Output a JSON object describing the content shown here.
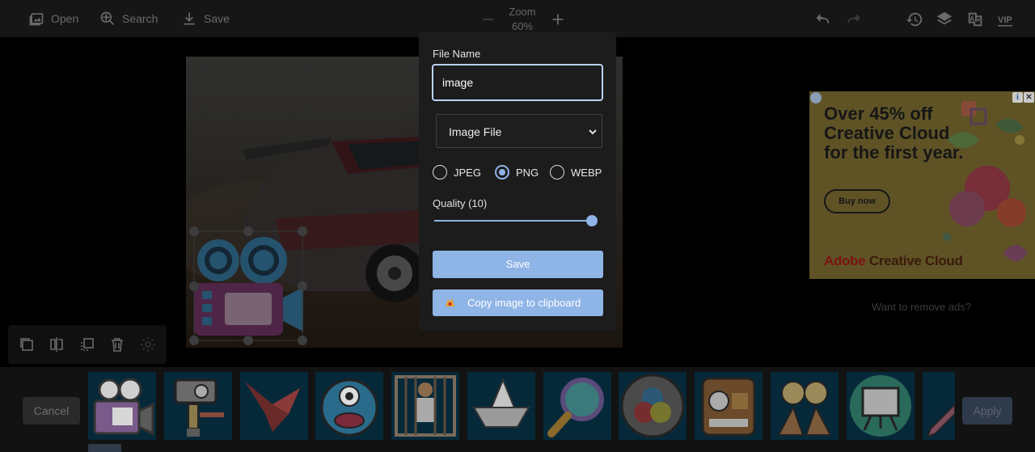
{
  "toolbar": {
    "open_label": "Open",
    "search_label": "Search",
    "save_label": "Save",
    "zoom_title": "Zoom",
    "zoom_value": "60%",
    "icons": [
      "image-icon",
      "globe-search-icon",
      "download-icon",
      "minus-icon",
      "plus-icon",
      "undo-icon",
      "redo-icon",
      "history-icon",
      "layers-icon",
      "translate-icon",
      "vip-icon"
    ],
    "vip_label": "VIP"
  },
  "dialog": {
    "file_name_label": "File Name",
    "file_name_value": "image",
    "format_select": "Image File",
    "formats": [
      {
        "label": "JPEG",
        "selected": false
      },
      {
        "label": "PNG",
        "selected": true
      },
      {
        "label": "WEBP",
        "selected": false
      }
    ],
    "quality_label": "Quality (10)",
    "quality_value": 10,
    "quality_fraction": 1.0,
    "save_button": "Save",
    "copy_button": "Copy image to clipboard",
    "accent_color": "#8fb4e6"
  },
  "ad": {
    "headline": "Over 45% off Creative Cloud for the first year.",
    "cta": "Buy now",
    "brand_red": "Adobe",
    "brand_rest": " Creative Cloud",
    "info_icon": "i",
    "close_icon": "✕",
    "remove_ads": "Want to remove ads?"
  },
  "edit_tools": [
    "duplicate-icon",
    "flip-icon",
    "bring-front-icon",
    "trash-icon",
    "settings-icon"
  ],
  "bottom": {
    "cancel_label": "Cancel",
    "apply_label": "Apply",
    "stickers": [
      "video-camera-sticker",
      "camera-rig-sticker",
      "origami-bird-sticker",
      "monster-sticker",
      "prisoner-sticker",
      "paper-boat-sticker",
      "magnifier-sticker",
      "color-circles-sticker",
      "radio-sticker",
      "lightbulb-hands-sticker",
      "easel-sticker",
      "pen-sticker"
    ]
  }
}
